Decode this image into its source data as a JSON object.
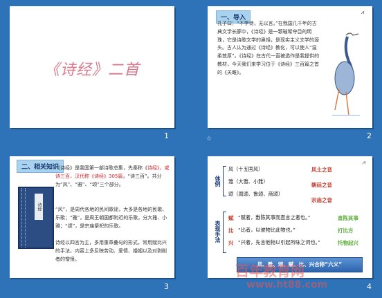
{
  "slides": [
    {
      "number": "1",
      "title": "《诗经》二首"
    },
    {
      "number": "2",
      "star": "☆",
      "header": "一、导入",
      "paragraph": "孔子曰：“不学诗，无以言。”在我国几千年的古典文学长廊中，《诗经》是一颗璀璨夺目的明珠，它是诗歌文学的鼻祖，是现实主义文学的源头。古人认为通过《诗经》教化，可以使人“温柔敦厚”。《诗经》在古代一直被选作是我提供的教材，今天我们来学习位于《诗经》三百篇之首的《关雎》。"
    },
    {
      "number": "3",
      "header": "二、相关知识",
      "book_label": "诗经",
      "p1_a": "《诗经》是我国第一部诗歌总集，先秦称《",
      "p1_red": "诗经》，或诗三百，汉代称《诗经》305篇",
      "p1_b": "，“诗三百”。共分为“风”、“雅”、“颂”三个部分。",
      "p2": "“风”，是周代各地的民间歌谣，大多是各地的民歌、乐歌；“雅”，是周王朝国都附近的乐歌，分大雅、小雅；“颂”，是宗庙祭祀的乐歌。",
      "p3": "诗经以四言为主，多用重章叠句的形式，常用赋比兴的手法，内容上多反映劳动、爱情、婚姻以及对剥削者的憎恨。"
    },
    {
      "number": "4",
      "side_top": "体例",
      "side_bottom": "表现手法",
      "rows": [
        {
          "text": "风（十五国风）",
          "tag": "风土之音"
        },
        {
          "text": "雅（大雅、小雅）",
          "tag": "朝廷之音"
        },
        {
          "text": "颂（周颂、鲁颂、商颂）",
          "tag": "宗庙之音"
        }
      ],
      "methods": [
        {
          "key": "赋",
          "text": "“赋者，敷陈其事而直言之者也。”",
          "tag": "直陈其事"
        },
        {
          "key": "比",
          "text": "“比者，以彼物比此物也。”",
          "tag": "打比方"
        },
        {
          "key": "兴",
          "text": "“兴者，先言他物以引起所咏之词也。”",
          "tag": "托物起兴"
        }
      ],
      "bar": "风、雅、颂、赋、比、兴合称“六义”"
    }
  ],
  "watermark": {
    "line1": "百年教育网",
    "line2": "www.ht88.com"
  },
  "colors": {
    "background": "#2e72b8",
    "title_pink": "#d97a8c",
    "accent_red": "#c0392b",
    "accent_green": "#5fae3b"
  }
}
